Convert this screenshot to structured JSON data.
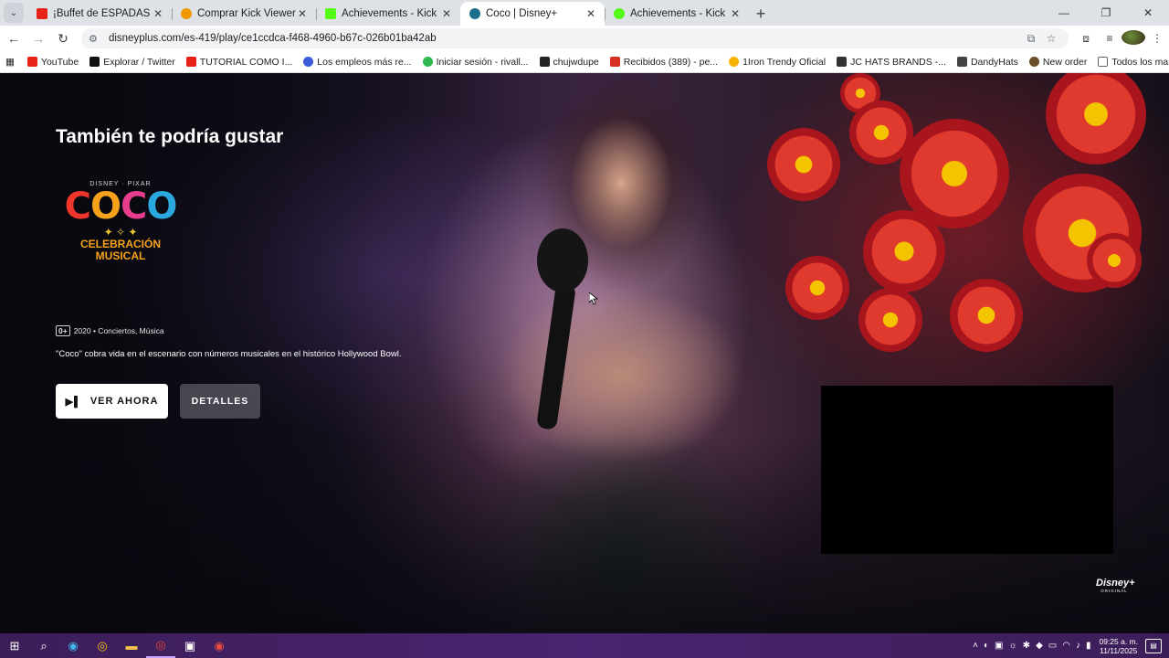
{
  "browser": {
    "tabs": [
      {
        "title": "¡Buffet de ESPADAS BRASILEÑAS",
        "favicon_color": "#e62117",
        "active": false
      },
      {
        "title": "Comprar Kick Viewers en línea",
        "favicon_color": "#f29900",
        "active": false
      },
      {
        "title": "Achievements - Kick Dashboard",
        "favicon_color": "#53fc18",
        "active": false
      },
      {
        "title": "Coco | Disney+",
        "favicon_color": "#1a6f8a",
        "active": true
      },
      {
        "title": "Achievements - Kick Dashboard",
        "favicon_color": "#53fc18",
        "active": false
      }
    ],
    "url": "disneyplus.com/es-419/play/ce1ccdca-f468-4960-b67c-026b01ba42ab",
    "bookmarks": [
      {
        "label": "YouTube",
        "color": "#e62117"
      },
      {
        "label": "Explorar / Twitter",
        "color": "#111111"
      },
      {
        "label": "TUTORIAL COMO I...",
        "color": "#e62117"
      },
      {
        "label": "Los empleos más re...",
        "color": "#3b5bdb"
      },
      {
        "label": "Iniciar sesión - rivall...",
        "color": "#2db84d"
      },
      {
        "label": "chujwdupe",
        "color": "#222222"
      },
      {
        "label": "Recibidos (389) - pe...",
        "color": "#d93025"
      },
      {
        "label": "1Iron Trendy Oficial",
        "color": "#f4b400"
      },
      {
        "label": "JC HATS BRANDS -...",
        "color": "#333333"
      },
      {
        "label": "DandyHats",
        "color": "#444444"
      },
      {
        "label": "New order",
        "color": "#6b4f2a"
      }
    ],
    "all_bookmarks_label": "Todos los marcadores"
  },
  "page": {
    "row_title": "También te podría gustar",
    "logo": {
      "brand": "DISNEY · PIXAR",
      "letters": [
        "C",
        "O",
        "C",
        "O"
      ],
      "line1": "CELEBRACIÓN",
      "line2": "MUSICAL"
    },
    "rating": "0+",
    "year_genres": "2020 • Conciertos, Música",
    "description": "\"Coco\" cobra vida en el escenario con números musicales en el histórico Hollywood Bowl.",
    "play_label": "VER AHORA",
    "details_label": "DETALLES",
    "badge_brand": "Disney+",
    "badge_sub": "ORIGINAL"
  },
  "taskbar": {
    "time": "09:25 a. m.",
    "date": "11/11/2025"
  },
  "colors": {
    "accent_play_button": "#ffffff",
    "details_button": "#787882",
    "taskbar": "#4a2470"
  }
}
